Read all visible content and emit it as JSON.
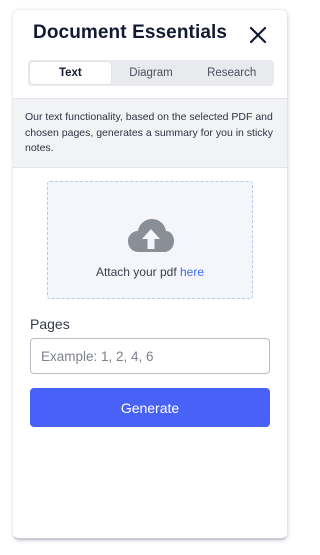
{
  "header": {
    "title": "Document Essentials",
    "close_icon": "close-icon"
  },
  "tabs": [
    {
      "label": "Text",
      "active": true
    },
    {
      "label": "Diagram",
      "active": false
    },
    {
      "label": "Research",
      "active": false
    }
  ],
  "info": {
    "text": "Our text functionality, based on the selected PDF and chosen pages, generates a summary for you in sticky notes."
  },
  "upload": {
    "icon": "cloud-upload-icon",
    "prefix": "Attach your pdf ",
    "link": "here"
  },
  "pages": {
    "label": "Pages",
    "placeholder": "Example: 1, 2, 4, 6",
    "value": ""
  },
  "generate": {
    "label": "Generate"
  },
  "colors": {
    "accent": "#4862f8",
    "link": "#3b6cf0",
    "title": "#141a33",
    "icon": "#8a8e96"
  }
}
